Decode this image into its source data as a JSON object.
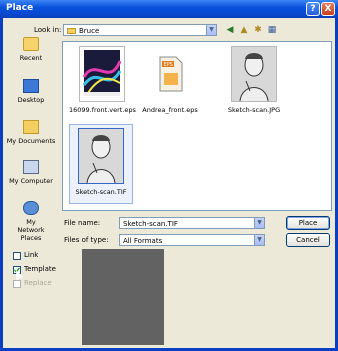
{
  "window": {
    "title": "Place"
  },
  "titlebar": {
    "help": "?",
    "close": "X"
  },
  "lookin": {
    "label": "Look in:",
    "value": "Bruce"
  },
  "places": [
    {
      "label": "Recent",
      "icon": "recent-icon"
    },
    {
      "label": "Desktop",
      "icon": "desktop-icon"
    },
    {
      "label": "My Documents",
      "icon": "my-documents-icon"
    },
    {
      "label": "My Computer",
      "icon": "my-computer-icon"
    },
    {
      "label": "My Network Places",
      "icon": "my-network-places-icon"
    }
  ],
  "files": [
    {
      "name": "16099.front.vert.eps",
      "kind": "eps-art"
    },
    {
      "name": "Andrea_front.eps",
      "kind": "eps-icon"
    },
    {
      "name": "Sketch-scan.JPG",
      "kind": "sketch"
    },
    {
      "name": "Sketch-scan.TIF",
      "kind": "sketch",
      "selected": true
    }
  ],
  "filename": {
    "label": "File name:",
    "value": "Sketch-scan.TIF"
  },
  "filetype": {
    "label": "Files of type:",
    "value": "All Formats"
  },
  "buttons": {
    "place": "Place",
    "cancel": "Cancel"
  },
  "options": {
    "link": {
      "label": "Link",
      "checked": false,
      "enabled": true
    },
    "template": {
      "label": "Template",
      "checked": true,
      "enabled": true
    },
    "replace": {
      "label": "Replace",
      "checked": false,
      "enabled": false
    }
  },
  "colors": {
    "titlebar": "#0a52dd",
    "dialog": "#ece9d8",
    "preview": "#626262"
  }
}
